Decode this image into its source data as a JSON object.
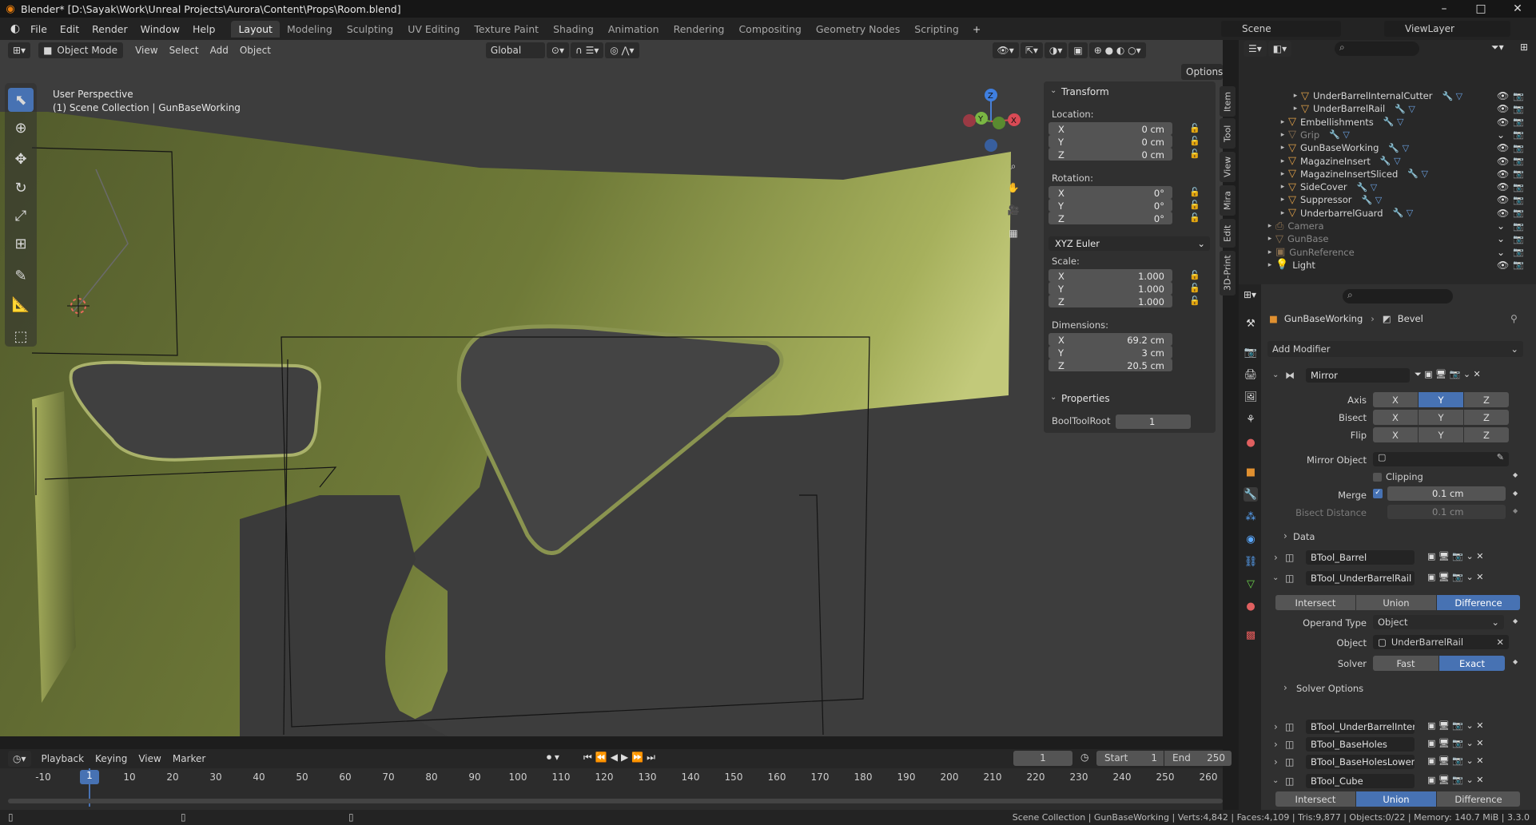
{
  "window": {
    "title": "Blender* [D:\\Sayak\\Work\\Unreal Projects\\Aurora\\Content\\Props\\Room.blend]",
    "min": "–",
    "max": "□",
    "close": "✕"
  },
  "menubar": {
    "menus": [
      "File",
      "Edit",
      "Render",
      "Window",
      "Help"
    ],
    "workspaces": [
      "Layout",
      "Modeling",
      "Sculpting",
      "UV Editing",
      "Texture Paint",
      "Shading",
      "Animation",
      "Rendering",
      "Compositing",
      "Geometry Nodes",
      "Scripting"
    ],
    "active_workspace": "Layout",
    "add_tab": "+",
    "scene": "Scene",
    "view_layer": "ViewLayer"
  },
  "viewport": {
    "mode": "Object Mode",
    "menus": [
      "View",
      "Select",
      "Add",
      "Object"
    ],
    "orientation": "Global",
    "options": "Options",
    "perspective": "User Perspective",
    "collection_info": "(1) Scene Collection | GunBaseWorking",
    "side_tabs": [
      "Item",
      "Tool",
      "View",
      "Mira",
      "Edit",
      "3D-Print"
    ],
    "gizmo": {
      "x": "X",
      "y": "Y",
      "z": "Z"
    }
  },
  "transform": {
    "header": "Transform",
    "location_label": "Location:",
    "location": [
      {
        "axis": "X",
        "value": "0 cm"
      },
      {
        "axis": "Y",
        "value": "0 cm"
      },
      {
        "axis": "Z",
        "value": "0 cm"
      }
    ],
    "rotation_label": "Rotation:",
    "rotation": [
      {
        "axis": "X",
        "value": "0°"
      },
      {
        "axis": "Y",
        "value": "0°"
      },
      {
        "axis": "Z",
        "value": "0°"
      }
    ],
    "rotation_mode": "XYZ Euler",
    "scale_label": "Scale:",
    "scale": [
      {
        "axis": "X",
        "value": "1.000"
      },
      {
        "axis": "Y",
        "value": "1.000"
      },
      {
        "axis": "Z",
        "value": "1.000"
      }
    ],
    "dimensions_label": "Dimensions:",
    "dimensions": [
      {
        "axis": "X",
        "value": "69.2 cm"
      },
      {
        "axis": "Y",
        "value": "3 cm"
      },
      {
        "axis": "Z",
        "value": "20.5 cm"
      }
    ],
    "properties_header": "Properties",
    "booltool_label": "BoolToolRoot",
    "booltool_value": "1"
  },
  "outliner": {
    "rows": [
      {
        "name": "UnderBarrelInternalCutter",
        "indent": 2,
        "dim": false
      },
      {
        "name": "UnderBarrelRail",
        "indent": 2,
        "dim": false
      },
      {
        "name": "Embellishments",
        "indent": 1,
        "dim": false
      },
      {
        "name": "Grip",
        "indent": 1,
        "dim": true
      },
      {
        "name": "GunBaseWorking",
        "indent": 1,
        "dim": false
      },
      {
        "name": "MagazineInsert",
        "indent": 1,
        "dim": false
      },
      {
        "name": "MagazineInsertSliced",
        "indent": 1,
        "dim": false
      },
      {
        "name": "SideCover",
        "indent": 1,
        "dim": false
      },
      {
        "name": "Suppressor",
        "indent": 1,
        "dim": false
      },
      {
        "name": "UnderbarrelGuard",
        "indent": 1,
        "dim": false
      },
      {
        "name": "Camera",
        "indent": 0,
        "dim": true
      },
      {
        "name": "GunBase",
        "indent": 0,
        "dim": true
      },
      {
        "name": "GunReference",
        "indent": 0,
        "dim": true
      },
      {
        "name": "Light",
        "indent": 0,
        "dim": false
      }
    ]
  },
  "properties": {
    "breadcrumb_object": "GunBaseWorking",
    "breadcrumb_modifier": "Bevel",
    "add_modifier": "Add Modifier",
    "mirror": {
      "name": "Mirror",
      "axis_label": "Axis",
      "bisect_label": "Bisect",
      "flip_label": "Flip",
      "axes": [
        "X",
        "Y",
        "Z"
      ],
      "mirror_object_label": "Mirror Object",
      "clipping_label": "Clipping",
      "merge_label": "Merge",
      "merge_value": "0.1 cm",
      "bisect_distance_label": "Bisect Distance",
      "bisect_distance_value": "0.1 cm",
      "data_label": "Data"
    },
    "btool_barrel": "BTool_Barrel",
    "btool_rail": {
      "name": "BTool_UnderBarrelRail",
      "ops": [
        "Intersect",
        "Union",
        "Difference"
      ],
      "operand_type_label": "Operand Type",
      "operand_type_value": "Object",
      "object_label": "Object",
      "object_value": "UnderBarrelRail",
      "solver_label": "Solver",
      "solver_fast": "Fast",
      "solver_exact": "Exact",
      "solver_options": "Solver Options"
    },
    "more_modifiers": [
      "BTool_UnderBarrelIntern...",
      "BTool_BaseHoles",
      "BTool_BaseHolesLower"
    ],
    "btool_cube": {
      "name": "BTool_Cube",
      "ops": [
        "Intersect",
        "Union",
        "Difference"
      ]
    }
  },
  "timeline": {
    "menus": [
      "Playback",
      "Keying",
      "View",
      "Marker"
    ],
    "current_frame": "1",
    "start_label": "Start",
    "start_value": "1",
    "end_label": "End",
    "end_value": "250",
    "ticks": [
      "-10",
      "10",
      "20",
      "30",
      "40",
      "50",
      "60",
      "70",
      "80",
      "90",
      "100",
      "110",
      "120",
      "130",
      "140",
      "150",
      "160",
      "170",
      "180",
      "190",
      "200",
      "210",
      "220",
      "230",
      "240",
      "250",
      "260"
    ]
  },
  "status": {
    "text": "Scene Collection | GunBaseWorking | Verts:4,842 | Faces:4,109 | Tris:9,877 | Objects:0/22 | Memory: 140.7 MiB | 3.3.0"
  }
}
